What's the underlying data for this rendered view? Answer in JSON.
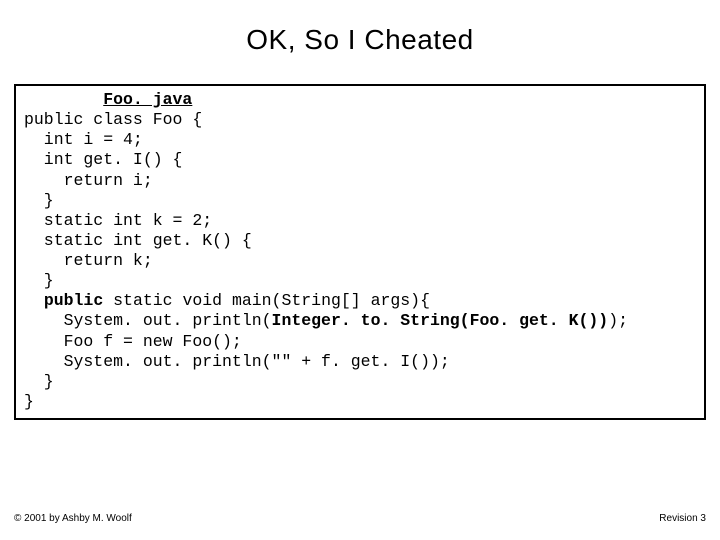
{
  "title": "OK, So I Cheated",
  "filename": "Foo. java",
  "code": {
    "l1": "public class Foo {",
    "l2": "  int i = 4;",
    "l3": "  int get. I() {",
    "l4": "    return i;",
    "l5": "  }",
    "l6": "  static int k = 2;",
    "l7": "  static int get. K() {",
    "l8": "    return k;",
    "l9": "  }",
    "l10a": "  ",
    "l10b": "public",
    "l10c": " static void main(String[] args){",
    "l11a": "    System. out. println(",
    "l11b": "Integer. to. String(Foo. get. K())",
    "l11c": ");",
    "l12": "    Foo f = new Foo();",
    "l13": "    System. out. println(\"\" + f. get. I());",
    "l14": "  }",
    "l15": "}"
  },
  "footer": {
    "left": "© 2001 by Ashby M. Woolf",
    "right": "Revision 3"
  }
}
